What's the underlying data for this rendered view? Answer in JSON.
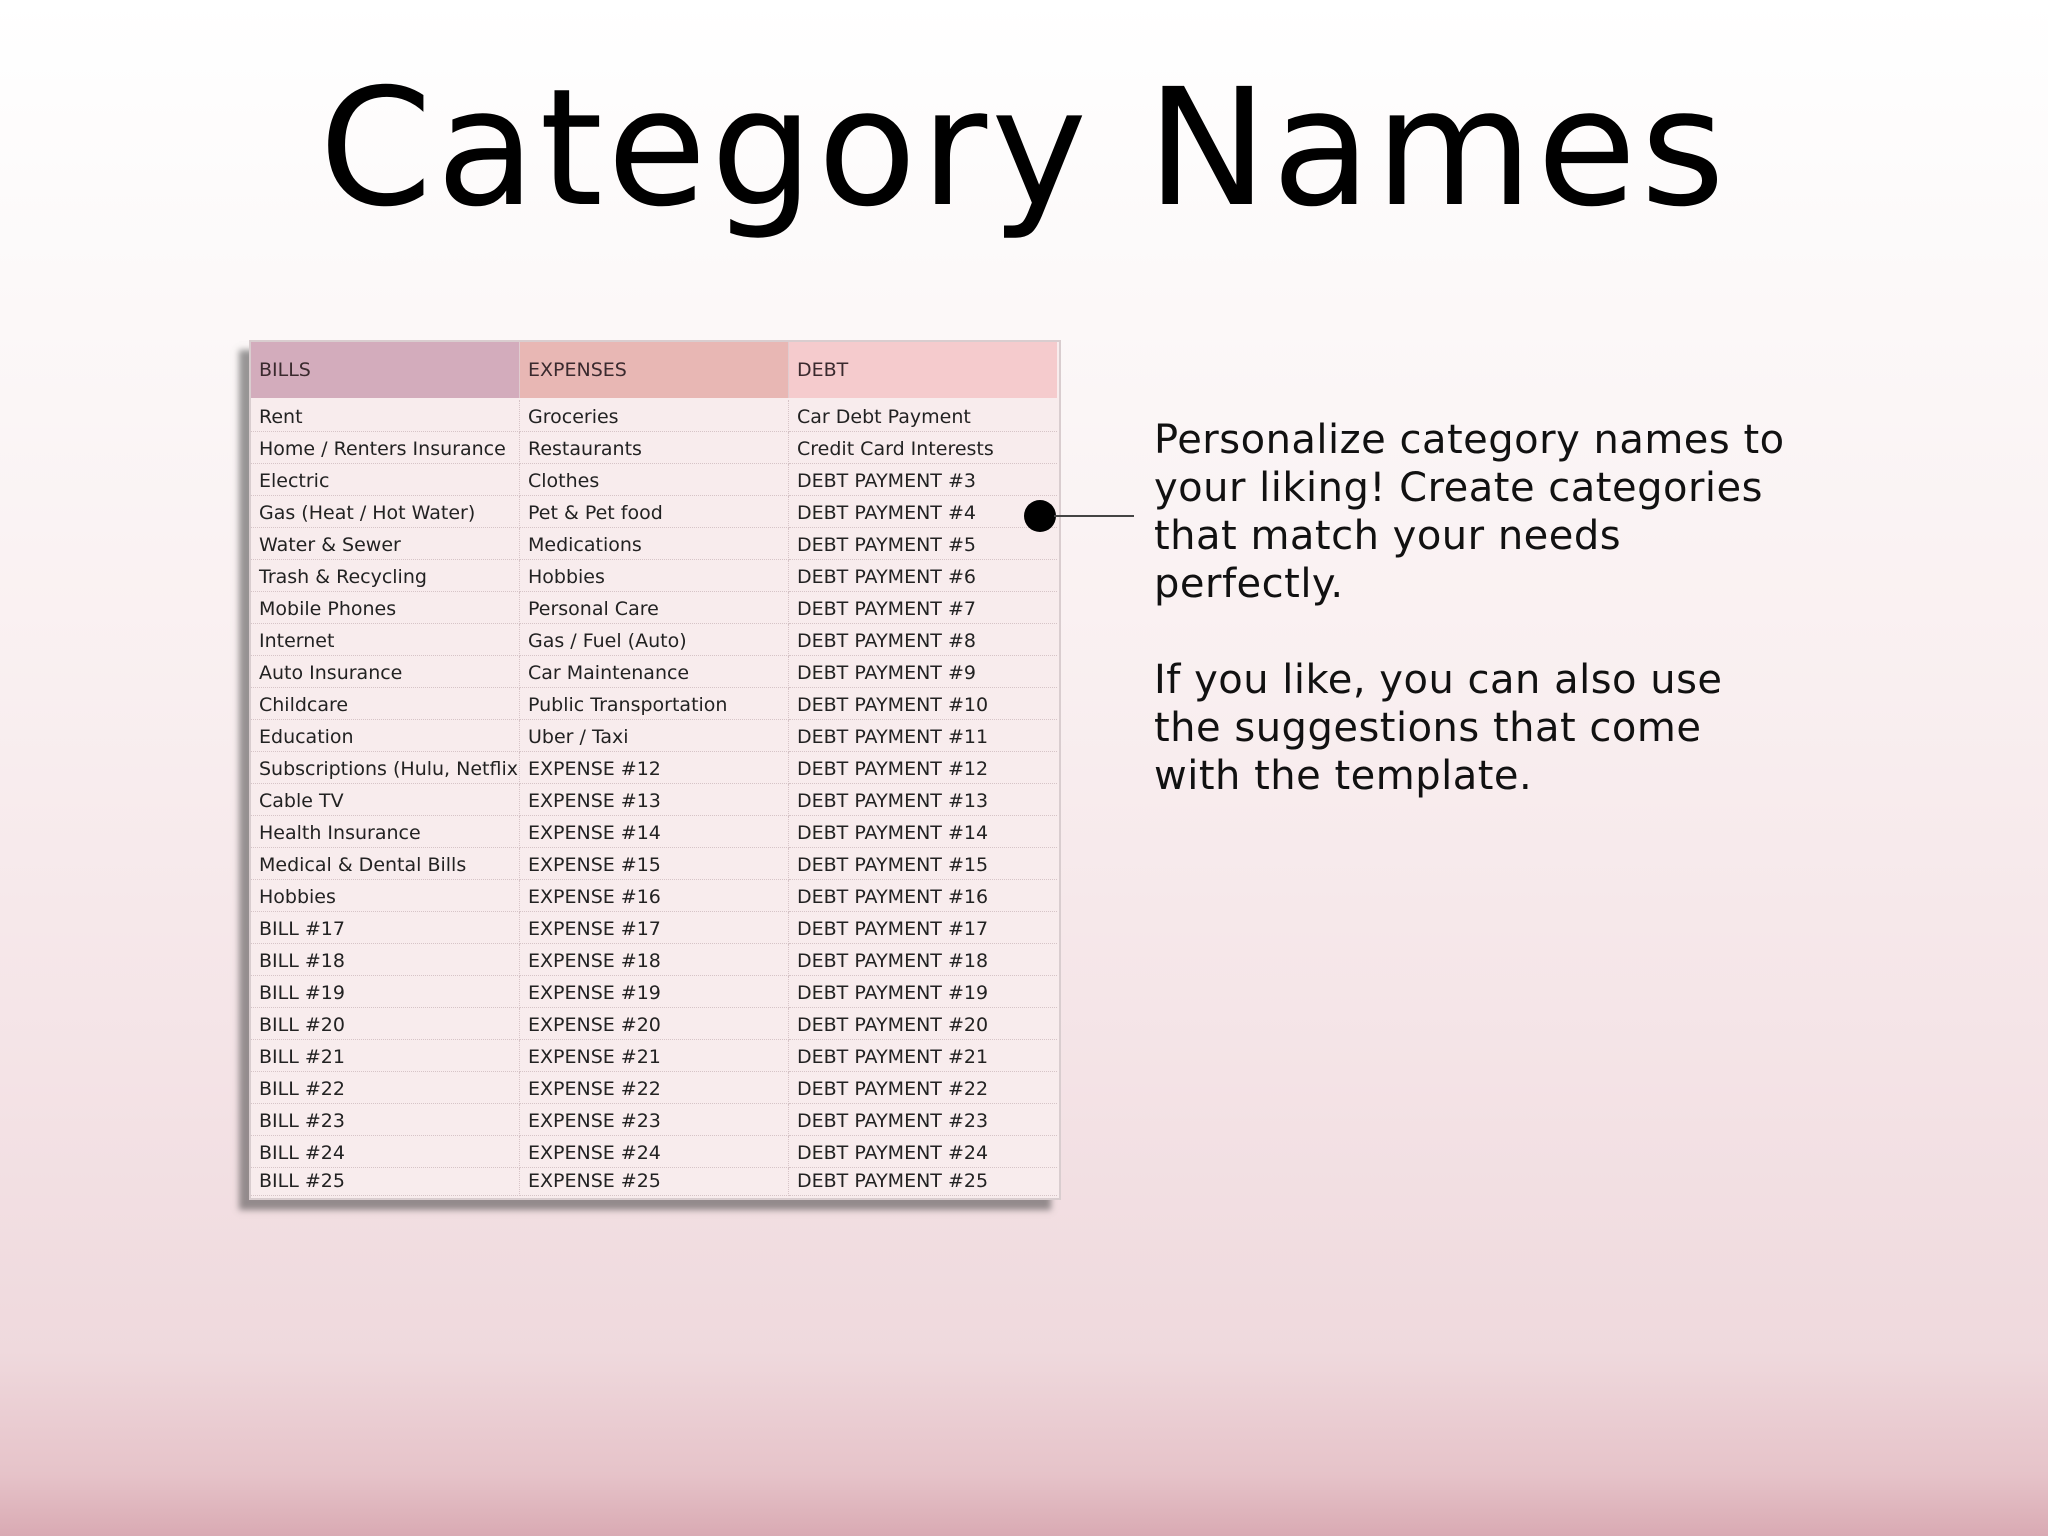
{
  "title": "Category Names",
  "sheet": {
    "headers": [
      "BILLS",
      "EXPENSES",
      "DEBT"
    ],
    "rows": [
      [
        "Rent",
        "Groceries",
        "Car Debt Payment"
      ],
      [
        "Home / Renters Insurance",
        "Restaurants",
        "Credit Card Interests"
      ],
      [
        "Electric",
        "Clothes",
        "DEBT PAYMENT #3"
      ],
      [
        "Gas (Heat / Hot Water)",
        "Pet & Pet food",
        "DEBT PAYMENT #4"
      ],
      [
        "Water & Sewer",
        "Medications",
        "DEBT PAYMENT #5"
      ],
      [
        "Trash & Recycling",
        "Hobbies",
        "DEBT PAYMENT #6"
      ],
      [
        "Mobile Phones",
        "Personal Care",
        "DEBT PAYMENT #7"
      ],
      [
        "Internet",
        "Gas / Fuel (Auto)",
        "DEBT PAYMENT #8"
      ],
      [
        "Auto Insurance",
        "Car Maintenance",
        "DEBT PAYMENT #9"
      ],
      [
        "Childcare",
        "Public Transportation",
        "DEBT PAYMENT #10"
      ],
      [
        "Education",
        "Uber / Taxi",
        "DEBT PAYMENT #11"
      ],
      [
        "Subscriptions (Hulu, Netflix",
        "EXPENSE #12",
        "DEBT PAYMENT #12"
      ],
      [
        "Cable TV",
        "EXPENSE #13",
        "DEBT PAYMENT #13"
      ],
      [
        "Health Insurance",
        "EXPENSE #14",
        "DEBT PAYMENT #14"
      ],
      [
        "Medical & Dental Bills",
        "EXPENSE #15",
        "DEBT PAYMENT #15"
      ],
      [
        "Hobbies",
        "EXPENSE #16",
        "DEBT PAYMENT #16"
      ],
      [
        "BILL #17",
        "EXPENSE #17",
        "DEBT PAYMENT #17"
      ],
      [
        "BILL #18",
        "EXPENSE #18",
        "DEBT PAYMENT #18"
      ],
      [
        "BILL #19",
        "EXPENSE #19",
        "DEBT PAYMENT #19"
      ],
      [
        "BILL #20",
        "EXPENSE #20",
        "DEBT PAYMENT #20"
      ],
      [
        "BILL #21",
        "EXPENSE #21",
        "DEBT PAYMENT #21"
      ],
      [
        "BILL #22",
        "EXPENSE #22",
        "DEBT PAYMENT #22"
      ],
      [
        "BILL #23",
        "EXPENSE #23",
        "DEBT PAYMENT #23"
      ],
      [
        "BILL #24",
        "EXPENSE #24",
        "DEBT PAYMENT #24"
      ],
      [
        "BILL #25",
        "EXPENSE #25",
        "DEBT PAYMENT #25"
      ]
    ]
  },
  "description": {
    "paragraph_1": "Personalize category names to your liking! Create categories that match your needs perfectly.",
    "paragraph_2": "If you like, you can also use the suggestions that come with the template."
  },
  "colors": {
    "bills_header": "#d3acbc",
    "expenses_header": "#e8b7b4",
    "debt_header": "#f5cbcd",
    "sheet_background": "#f8eced"
  }
}
